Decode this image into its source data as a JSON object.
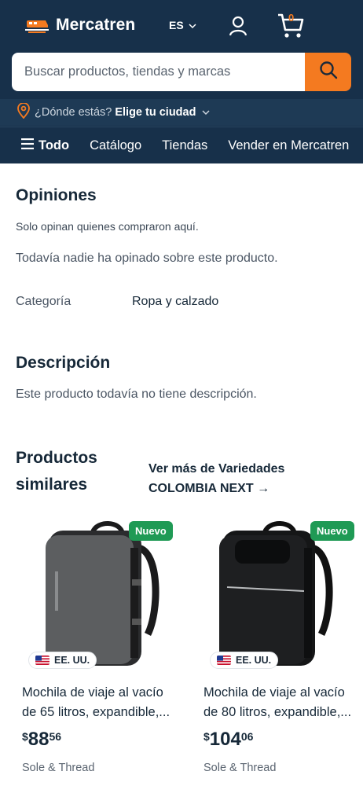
{
  "header": {
    "brand": "Mercatren",
    "language": "ES",
    "cart_count": "0",
    "search_placeholder": "Buscar productos, tiendas y marcas",
    "location_prompt": "¿Dónde estás?",
    "location_action": "Elige tu ciudad",
    "nav": [
      "Todo",
      "Catálogo",
      "Tiendas",
      "Vender en Mercatren"
    ]
  },
  "reviews": {
    "title": "Opiniones",
    "note": "Solo opinan quienes compraron aquí.",
    "empty": "Todavía nadie ha opinado sobre este producto."
  },
  "category": {
    "label": "Categoría",
    "value": "Ropa y calzado"
  },
  "description": {
    "title": "Descripción",
    "text": "Este producto todavía no tiene descripción."
  },
  "similar": {
    "title": "Productos similares",
    "see_more": "Ver más de Variedades COLOMBIA NEXT →",
    "products": [
      {
        "badge": "Nuevo",
        "origin": "EE. UU.",
        "title": "Mochila de viaje al vacío de 65 litros, expandible,...",
        "price_currency": "$",
        "price_int": "88",
        "price_dec": "56",
        "seller": "Sole & Thread",
        "color": "#5c5e60"
      },
      {
        "badge": "Nuevo",
        "origin": "EE. UU.",
        "title": "Mochila de viaje al vacío de 80 litros, expandible,...",
        "price_currency": "$",
        "price_int": "104",
        "price_dec": "06",
        "seller": "Sole & Thread",
        "color": "#1e1f21"
      }
    ]
  },
  "colors": {
    "header_bg": "#17304a",
    "accent": "#f47a20",
    "badge_green": "#1f9a55"
  }
}
